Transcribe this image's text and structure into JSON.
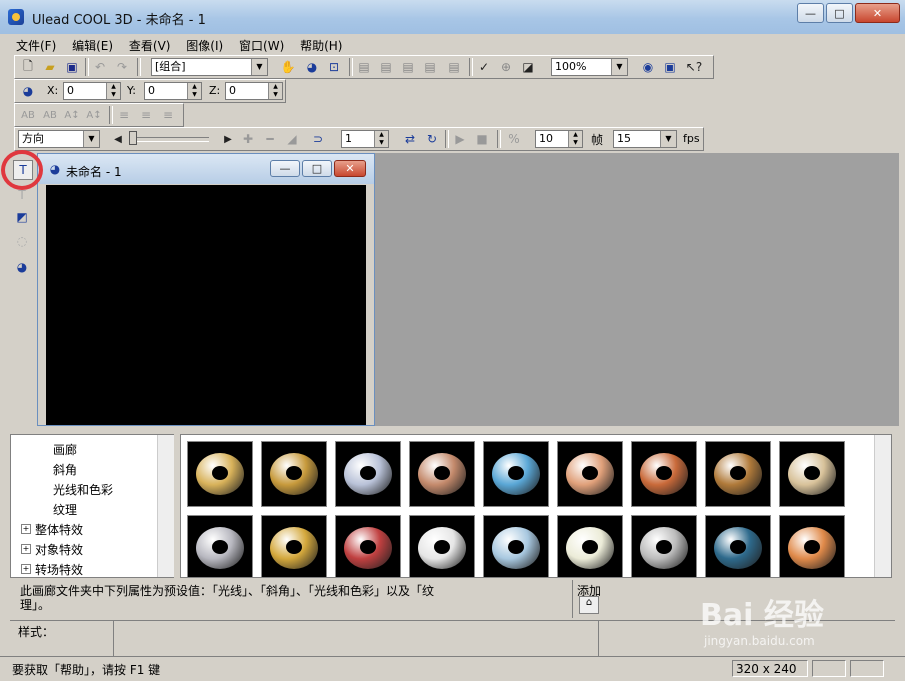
{
  "window": {
    "title": "Ulead COOL 3D - 未命名 - 1",
    "minimize_glyph": "—",
    "maximize_glyph": "□",
    "close_glyph": "✕"
  },
  "menu": [
    "文件(F)",
    "编辑(E)",
    "查看(V)",
    "图像(I)",
    "窗口(W)",
    "帮助(H)"
  ],
  "toolbar1": {
    "object_combo": "[组合]",
    "zoom_combo": "100%"
  },
  "toolbar2": {
    "x_label": "X:",
    "x_value": "0",
    "y_label": "Y:",
    "y_value": "0",
    "z_label": "Z:",
    "z_value": "0"
  },
  "toolbar3": {
    "direction_combo": "方向",
    "frame_value": "1",
    "frames_total": "10",
    "frames_label": "帧",
    "fps_value": "15",
    "fps_label": "fps"
  },
  "document": {
    "title": "未命名 - 1"
  },
  "tree": {
    "items": [
      "画廊",
      "斜角",
      "光线和色彩",
      "纹理",
      "整体特效",
      "对象特效",
      "转场特效"
    ]
  },
  "gallery": {
    "row1_colors": [
      "#d8b25a",
      "#c79a3c",
      "#b9c2d8",
      "#c48a6c",
      "#5aa7d6",
      "#e0a07a",
      "#c96a3a",
      "#b07a3a",
      "#d8c29a"
    ],
    "row2_colors": [
      "#b8b8c0",
      "#d4a83c",
      "#c04040",
      "#e6e6e6",
      "#a8c8e0",
      "#ececd8",
      "#bcbcbc",
      "#2e6a8c",
      "#e08a4a"
    ]
  },
  "description": {
    "text_line1": "此画廊文件夹中下列属性为预设值：「光线」、「斜角」、「光线和色彩」以及「纹",
    "text_line2": "理」。",
    "add_label": "添加"
  },
  "style_label": "样式：",
  "status": {
    "hint": "要获取「帮助」，请按 F1 键",
    "size": "320 x 240"
  },
  "watermark": {
    "brand": "Bai 经验",
    "url": "jingyan.baidu.com"
  },
  "colors": {
    "titlebar": "#a8c6e6",
    "face": "#d4d0c8",
    "highlight_circle": "#e0383e"
  }
}
